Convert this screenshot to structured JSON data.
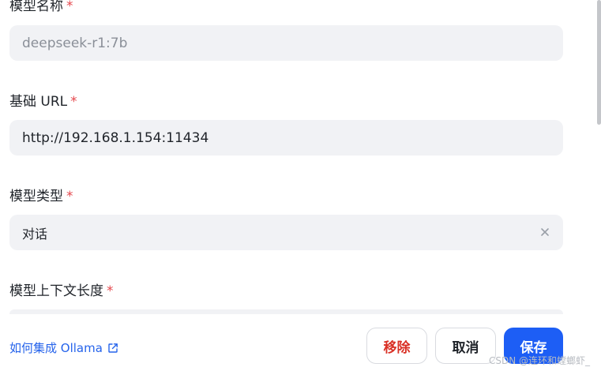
{
  "form": {
    "model_name": {
      "label": "模型名称",
      "required_mark": "*",
      "placeholder": "deepseek-r1:7b",
      "value": ""
    },
    "base_url": {
      "label": "基础 URL",
      "required_mark": "*",
      "value": "http://192.168.1.154:11434"
    },
    "model_type": {
      "label": "模型类型",
      "required_mark": "*",
      "value": "对话",
      "clear_icon": "close-icon"
    },
    "context_length": {
      "label": "模型上下文长度",
      "required_mark": "*"
    }
  },
  "footer": {
    "help_link": "如何集成 Ollama",
    "help_link_icon": "external-link-icon",
    "remove_label": "移除",
    "cancel_label": "取消",
    "save_label": "保存"
  },
  "watermark": "CSDN @连环和螳螂虾_",
  "colors": {
    "accent": "#1d5ef5",
    "danger": "#d93025",
    "required": "#e5484d",
    "field_bg": "#f1f2f5",
    "link": "#2563eb"
  }
}
